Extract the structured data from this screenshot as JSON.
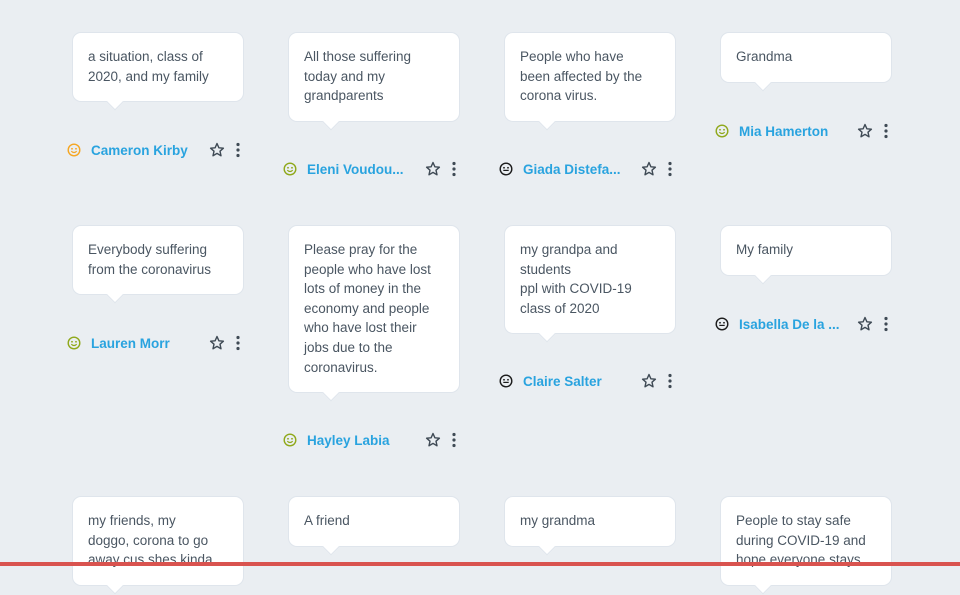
{
  "colors": {
    "accent_name": "#29a3df",
    "bottom_line": "#d9534f",
    "face_orange": "#f5a623",
    "face_green": "#8fa81a",
    "face_black": "#1b1b1b"
  },
  "cards": [
    {
      "text": "a situation, class of\n2020, and my family",
      "author": "Cameron Kirby",
      "face": "orange-smiley-icon"
    },
    {
      "text": "All those suffering\ntoday and my\ngrandparents",
      "author": "Eleni Voudou...",
      "face": "green-smiley-icon"
    },
    {
      "text": "People who have\nbeen affected by the\ncorona virus.",
      "author": "Giada Distefa...",
      "face": "black-smiley-icon"
    },
    {
      "text": "Grandma",
      "author": "Mia Hamerton",
      "face": "green-smiley-icon"
    },
    {
      "text": "Everybody suffering\nfrom the coronavirus",
      "author": "Lauren Morr",
      "face": "green-smiley-icon"
    },
    {
      "text": "Please pray for the\npeople who have lost\nlots of money in the\neconomy and people\nwho have lost their\njobs due to the\ncoronavirus.",
      "author": "Hayley Labia",
      "face": "green-smiley-icon"
    },
    {
      "text": "my grandpa and\nstudents\nppl with COVID-19\nclass of 2020",
      "author": "Claire Salter",
      "face": "black-smiley-icon"
    },
    {
      "text": "My family",
      "author": "Isabella De la ...",
      "face": "black-smiley-icon"
    },
    {
      "text": "my friends, my\ndoggo, corona to go\naway cus shes kinda",
      "author": "",
      "face": ""
    },
    {
      "text": "A friend",
      "author": "",
      "face": ""
    },
    {
      "text": "my grandma",
      "author": "",
      "face": ""
    },
    {
      "text": "People to stay safe\nduring COVID-19 and\nhope everyone stays",
      "author": "",
      "face": ""
    }
  ]
}
